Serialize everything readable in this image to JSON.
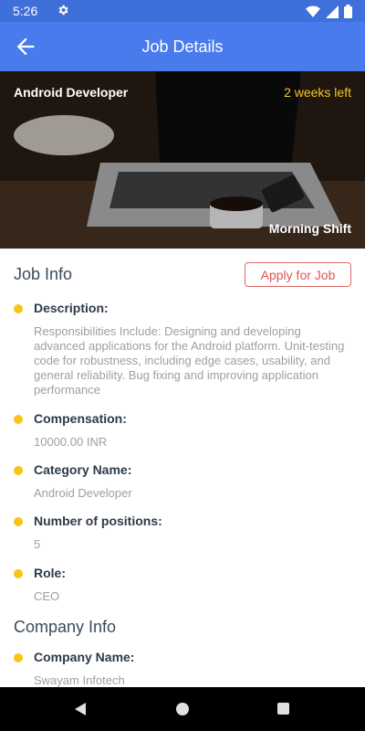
{
  "status_bar": {
    "time": "5:26"
  },
  "app_bar": {
    "title": "Job Details"
  },
  "hero": {
    "job_title": "Android Developer",
    "time_left": "2 weeks left",
    "shift": "Morning Shift"
  },
  "job_info": {
    "heading": "Job Info",
    "apply_label": "Apply for Job",
    "fields": [
      {
        "label": "Description:",
        "value": "Responsibilities Include: Designing and developing advanced applications for the Android platform. Unit-testing code for robustness, including edge cases, usability, and general reliability. Bug fixing and improving application performance"
      },
      {
        "label": "Compensation:",
        "value": "10000.00 INR"
      },
      {
        "label": "Category Name:",
        "value": "Android Developer"
      },
      {
        "label": "Number of positions:",
        "value": "5"
      },
      {
        "label": "Role:",
        "value": "CEO"
      }
    ]
  },
  "company_info": {
    "heading": "Company Info",
    "fields": [
      {
        "label": "Company Name:",
        "value": "Swayam Infotech"
      }
    ]
  },
  "colors": {
    "app_bar": "#4a7bec",
    "accent_yellow": "#f5c518",
    "apply_red": "#e05555"
  }
}
